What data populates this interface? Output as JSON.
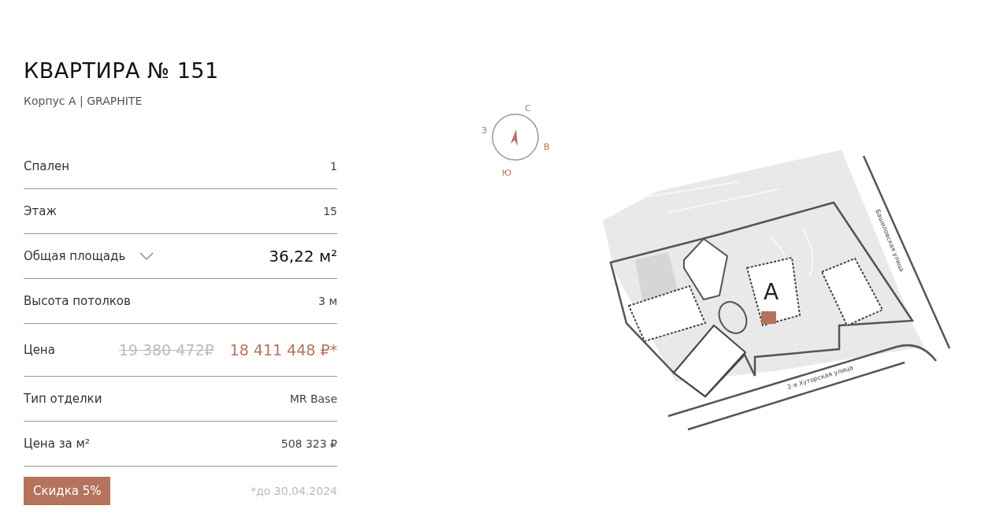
{
  "apartment": {
    "title": "КВАРТИРА № 151",
    "subtitle": "Корпус А | GRAPHITE"
  },
  "specs": [
    {
      "kind": "plain",
      "label": "Спален",
      "value": "1"
    },
    {
      "kind": "plain",
      "label": "Этаж",
      "value": "15"
    },
    {
      "kind": "expandable",
      "label": "Общая площадь",
      "value": "36,22 м²",
      "expanded": false
    },
    {
      "kind": "plain",
      "label": "Высота потолков",
      "value": "3 м"
    },
    {
      "kind": "price",
      "label": "Цена",
      "old_value": "19 380 472₽",
      "value": "18 411 448 ₽*"
    },
    {
      "kind": "plain",
      "label": "Тип отделки",
      "value": "MR Base"
    },
    {
      "kind": "plain",
      "label": "Цена за м²",
      "value": "508 323 ₽"
    }
  ],
  "discount": {
    "badge": "Скидка 5%",
    "note": "*до 30.04.2024"
  },
  "compass": {
    "north": "С",
    "west": "З",
    "east": "В",
    "south": "Ю"
  },
  "site_plan": {
    "building": "А",
    "streets": [
      "Башиловская улица",
      "2-я Хуторская улица"
    ]
  }
}
